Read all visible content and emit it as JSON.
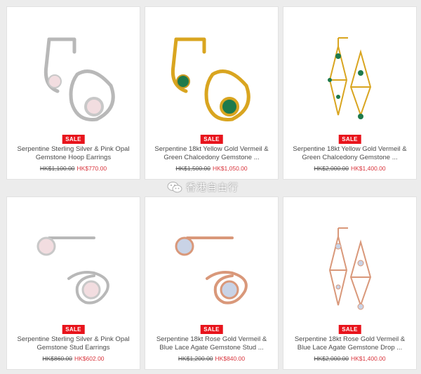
{
  "products": [
    {
      "badge": "SALE",
      "title": "Serpentine Sterling Silver & Pink Opal Gemstone Hoop Earrings",
      "old_price": "HK$1,100.00",
      "new_price": "HK$770.00",
      "image_icon": "silver-pink-opal-hoop-earrings-icon",
      "metal_color": "#b8b8b8",
      "stone_color": "#f2dde0"
    },
    {
      "badge": "SALE",
      "title": "Serpentine 18kt Yellow Gold Vermeil & Green Chalcedony Gemstone ...",
      "old_price": "HK$1,500.00",
      "new_price": "HK$1,050.00",
      "image_icon": "gold-green-chalcedony-hoop-earrings-icon",
      "metal_color": "#d9a520",
      "stone_color": "#1e7a4c"
    },
    {
      "badge": "SALE",
      "title": "Serpentine 18kt Yellow Gold Vermeil & Green Chalcedony Gemstone ...",
      "old_price": "HK$2,000.00",
      "new_price": "HK$1,400.00",
      "image_icon": "gold-green-chalcedony-drop-earrings-icon",
      "metal_color": "#d9a520",
      "stone_color": "#1e7a4c"
    },
    {
      "badge": "SALE",
      "title": "Serpentine Sterling Silver & Pink Opal Gemstone Stud Earrings",
      "old_price": "HK$860.00",
      "new_price": "HK$602.00",
      "image_icon": "silver-pink-opal-stud-earrings-icon",
      "metal_color": "#b8b8b8",
      "stone_color": "#f2dde0"
    },
    {
      "badge": "SALE",
      "title": "Serpentine 18kt Rose Gold Vermeil & Blue Lace Agate Gemstone Stud ...",
      "old_price": "HK$1,200.00",
      "new_price": "HK$840.00",
      "image_icon": "rose-gold-blue-lace-agate-stud-earrings-icon",
      "metal_color": "#d9987a",
      "stone_color": "#c9d3e6"
    },
    {
      "badge": "SALE",
      "title": "Serpentine 18kt Rose Gold Vermeil & Blue Lace Agate Gemstone Drop ...",
      "old_price": "HK$2,000.00",
      "new_price": "HK$1,400.00",
      "image_icon": "rose-gold-blue-lace-agate-drop-earrings-icon",
      "metal_color": "#d9987a",
      "stone_color": "#c9d3e6"
    }
  ],
  "watermark": {
    "text": "香港自由行",
    "icon": "wechat-icon"
  },
  "colors": {
    "sale_red": "#e8141c",
    "price_red": "#d9363e",
    "background": "#ececec"
  }
}
